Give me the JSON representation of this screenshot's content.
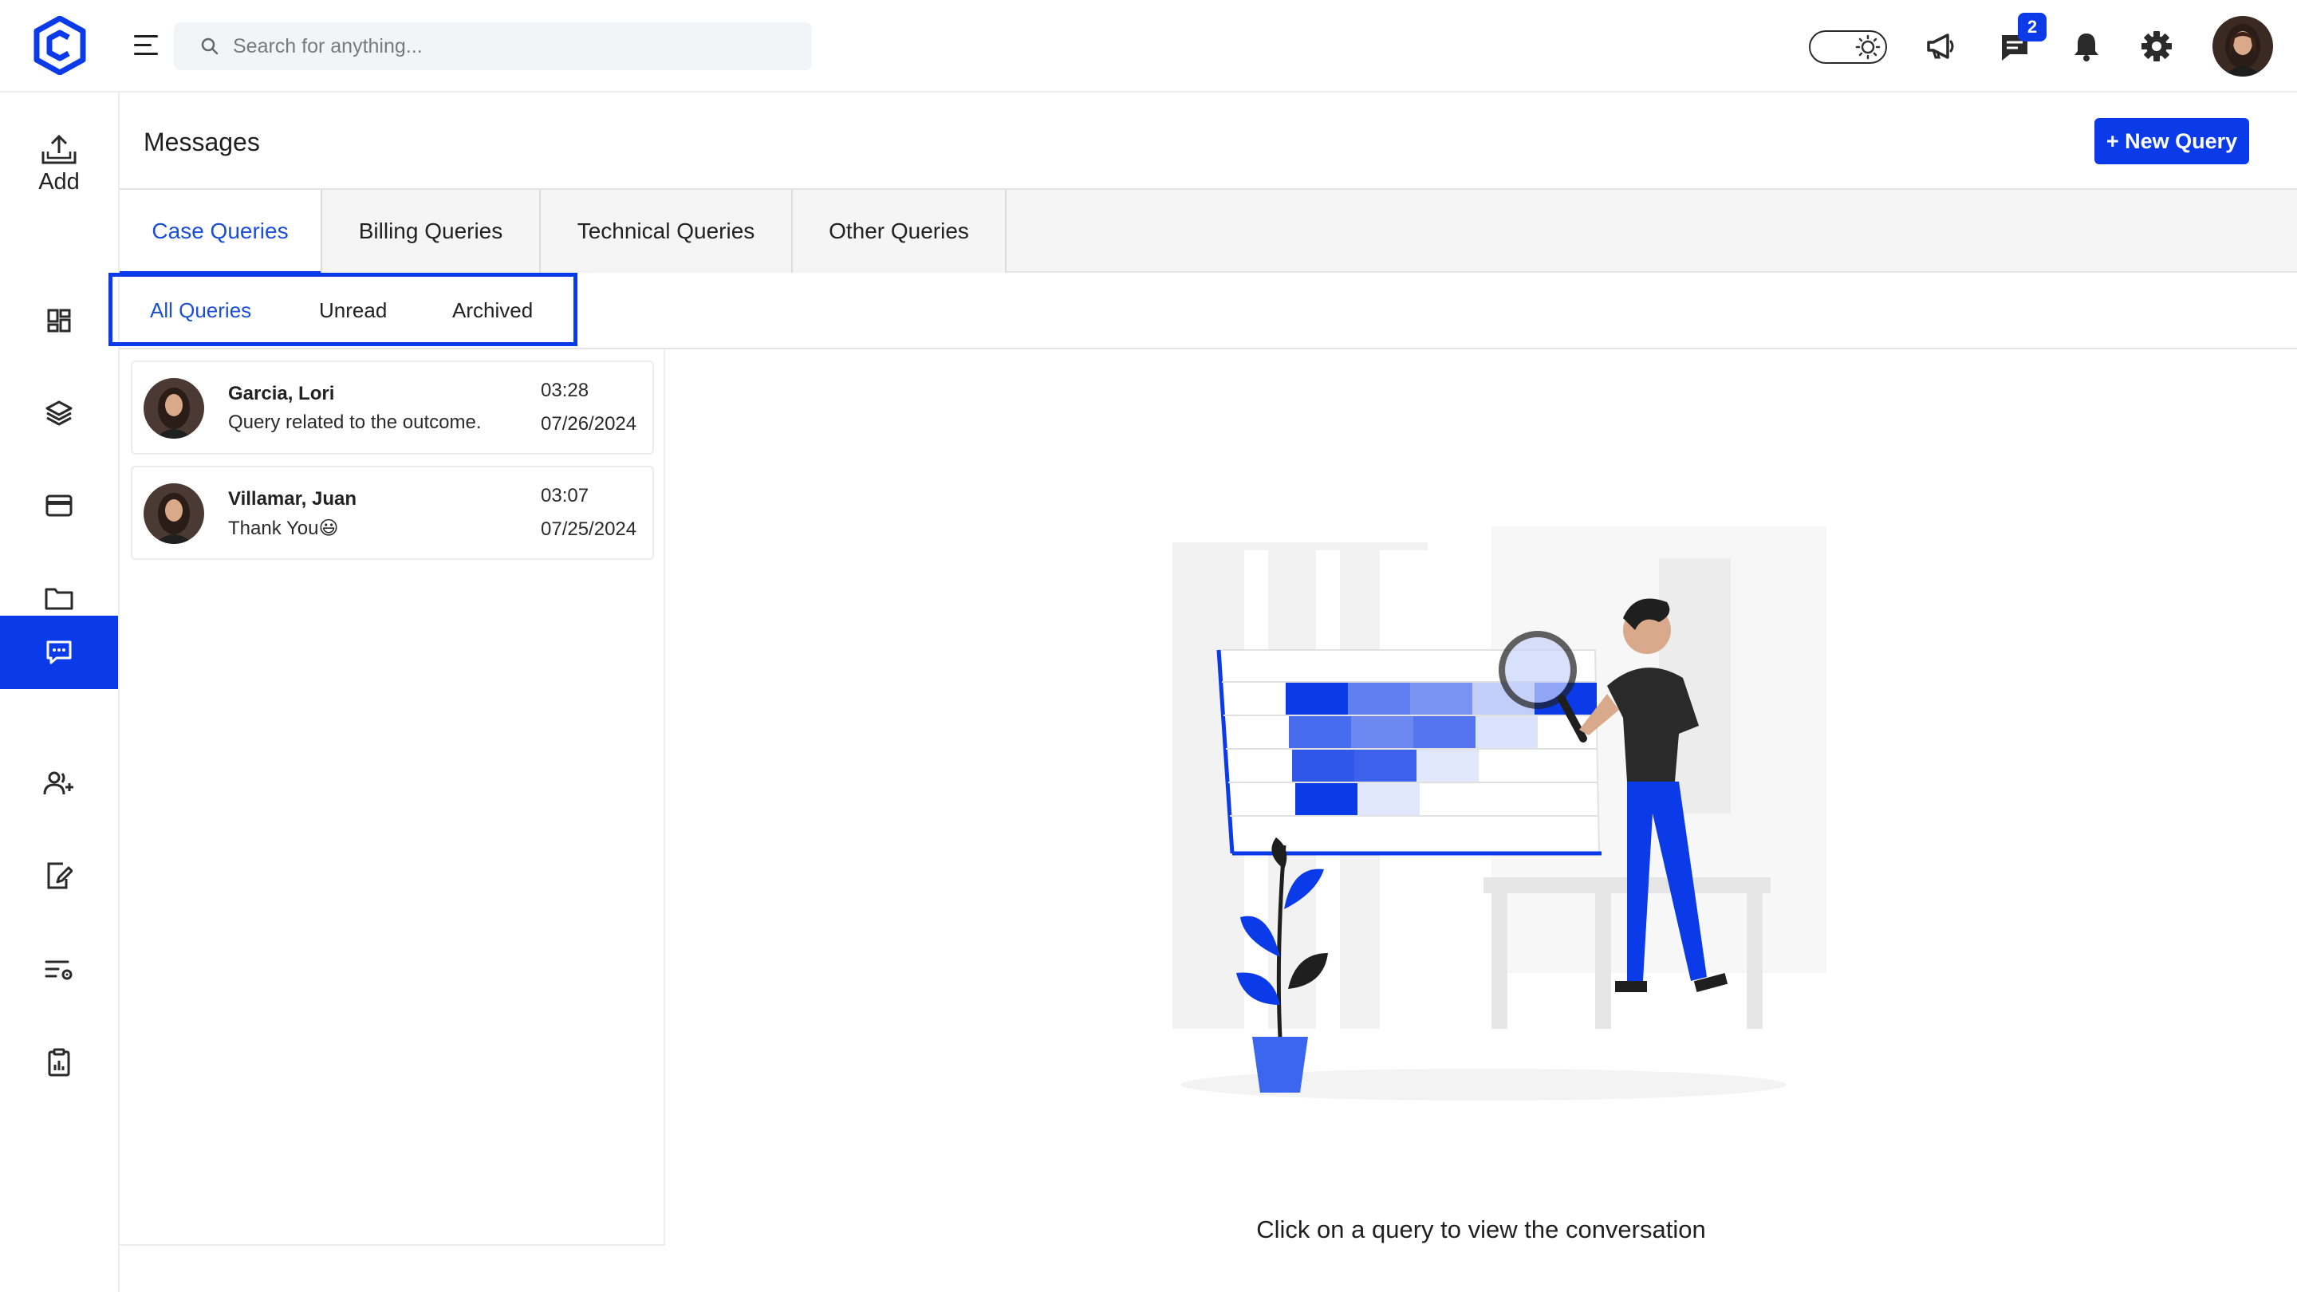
{
  "header": {
    "search_placeholder": "Search for anything...",
    "chat_badge": "2"
  },
  "sidebar": {
    "add_label": "Add",
    "items": [
      "dashboard-icon",
      "layers-icon",
      "card-icon",
      "folder-icon",
      "messages-icon",
      "add-user-icon",
      "edit-document-icon",
      "list-settings-icon",
      "report-clipboard-icon"
    ],
    "active_item": "messages-icon"
  },
  "page": {
    "title": "Messages",
    "new_query_label": "+ New Query"
  },
  "tabs": [
    {
      "label": "Case Queries",
      "active": true
    },
    {
      "label": "Billing Queries",
      "active": false
    },
    {
      "label": "Technical Queries",
      "active": false
    },
    {
      "label": "Other Queries",
      "active": false
    }
  ],
  "subtabs": [
    {
      "label": "All Queries",
      "active": true
    },
    {
      "label": "Unread",
      "active": false
    },
    {
      "label": "Archived",
      "active": false
    }
  ],
  "queries": [
    {
      "name": "Garcia, Lori",
      "preview": "Query related to the outcome.",
      "time": "03:28",
      "date": "07/26/2024"
    },
    {
      "name": "Villamar, Juan",
      "preview": "Thank You😃",
      "time": "03:07",
      "date": "07/25/2024"
    }
  ],
  "empty_state": {
    "message": "Click on a query to view the conversation"
  },
  "colors": {
    "accent": "#0b3be8",
    "active_tab_text": "#1c4fd8"
  }
}
